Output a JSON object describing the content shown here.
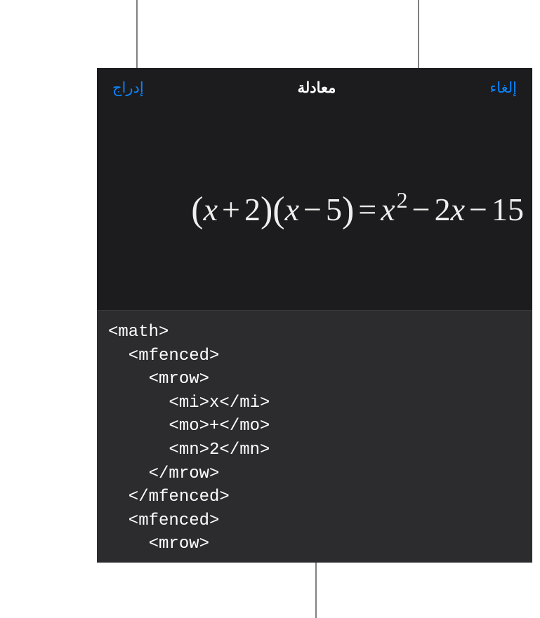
{
  "header": {
    "cancel_label": "إلغاء",
    "title": "معادلة",
    "insert_label": "إدراج"
  },
  "equation": {
    "rendered_parts": {
      "lparen1": "(",
      "x1": "x",
      "plus": "+",
      "two": "2",
      "rparen1": ")",
      "lparen2": "(",
      "x2": "x",
      "minus1": "−",
      "five": "5",
      "rparen2": ")",
      "equals": "=",
      "x3": "x",
      "sup2": "2",
      "minus2": "−",
      "coef2": "2",
      "x4": "x",
      "minus3": "−",
      "fifteen": "15"
    }
  },
  "code": {
    "source": "<math>\n  <mfenced>\n    <mrow>\n      <mi>x</mi>\n      <mo>+</mo>\n      <mn>2</mn>\n    </mrow>\n  </mfenced>\n  <mfenced>\n    <mrow>"
  }
}
